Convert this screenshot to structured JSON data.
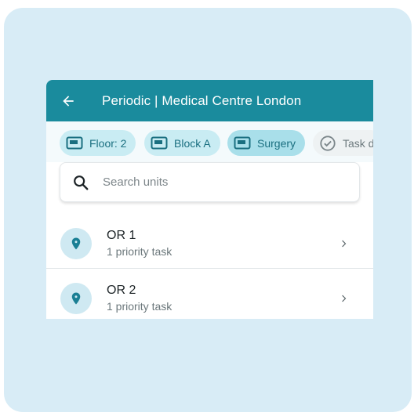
{
  "appbar": {
    "title": "Periodic | Medical Centre London",
    "back_icon": "arrow-back-icon"
  },
  "chips": [
    {
      "label": "Floor: 2",
      "icon": "location-square-icon",
      "selected": false
    },
    {
      "label": "Block A",
      "icon": "location-square-icon",
      "selected": false
    },
    {
      "label": "Surgery",
      "icon": "location-square-icon",
      "selected": true
    },
    {
      "label": "Task d",
      "icon": "check-circle-icon",
      "selected": false
    }
  ],
  "search": {
    "placeholder": "Search units",
    "icon": "search-icon"
  },
  "units": [
    {
      "title": "OR 1",
      "subtitle": "1 priority task",
      "icon": "map-pin-icon"
    },
    {
      "title": "OR 2",
      "subtitle": "1 priority task",
      "icon": "map-pin-icon"
    }
  ],
  "colors": {
    "primary": "#1a8b9d",
    "frame_background": "#d8ecf6",
    "chip_background": "#c9ecf3",
    "avatar_background": "#cfe9f2"
  }
}
